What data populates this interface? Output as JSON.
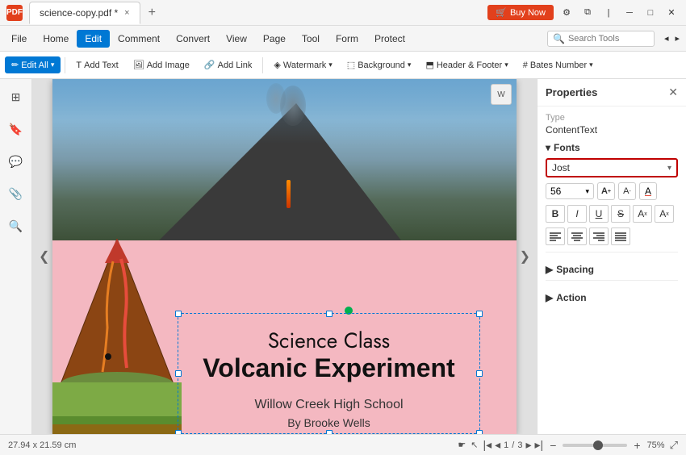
{
  "titlebar": {
    "logo": "PDF",
    "tab_name": "science-copy.pdf *",
    "close_tab": "×",
    "new_tab": "+",
    "buy_now": "Buy Now",
    "window_minimize": "─",
    "window_maximize": "□",
    "window_close": "✕"
  },
  "menubar": {
    "file": "File",
    "home": "Home",
    "edit": "Edit",
    "comment": "Comment",
    "convert": "Convert",
    "view": "View",
    "page": "Page",
    "tool": "Tool",
    "form": "Form",
    "protect": "Protect",
    "search_placeholder": "Search Tools"
  },
  "toolbar": {
    "edit_all": "Edit All",
    "add_text": "Add Text",
    "add_image": "Add Image",
    "add_link": "Add Link",
    "watermark": "Watermark",
    "background": "Background",
    "header_footer": "Header & Footer",
    "bates_number": "Bates Number"
  },
  "canvas": {
    "science_class": "Science Class",
    "volcanic_experiment": "Volcanic Experiment",
    "school": "Willow Creek High School",
    "author": "By Brooke Wells",
    "wps_icon": "W"
  },
  "nav": {
    "left_arrow": "❮",
    "right_arrow": "❯"
  },
  "properties_panel": {
    "title": "Properties",
    "close": "✕",
    "type_label": "Type",
    "type_value": "ContentText",
    "fonts_section": "Fonts",
    "font_name": "Jost",
    "font_size": "56",
    "size_up": "A",
    "size_down": "A",
    "color_icon": "A",
    "bold": "B",
    "italic": "I",
    "underline": "U",
    "strikethrough": "S",
    "superscript": "A",
    "subscript": "A",
    "align_left": "≡",
    "align_center": "≡",
    "align_right": "≡",
    "align_justify": "≡",
    "spacing_section": "Spacing",
    "action_section": "Action",
    "section_arrow": "▶"
  },
  "statusbar": {
    "dimensions": "27.94 x 21.59 cm",
    "page_current": "1",
    "page_total": "3",
    "zoom_level": "75%"
  }
}
